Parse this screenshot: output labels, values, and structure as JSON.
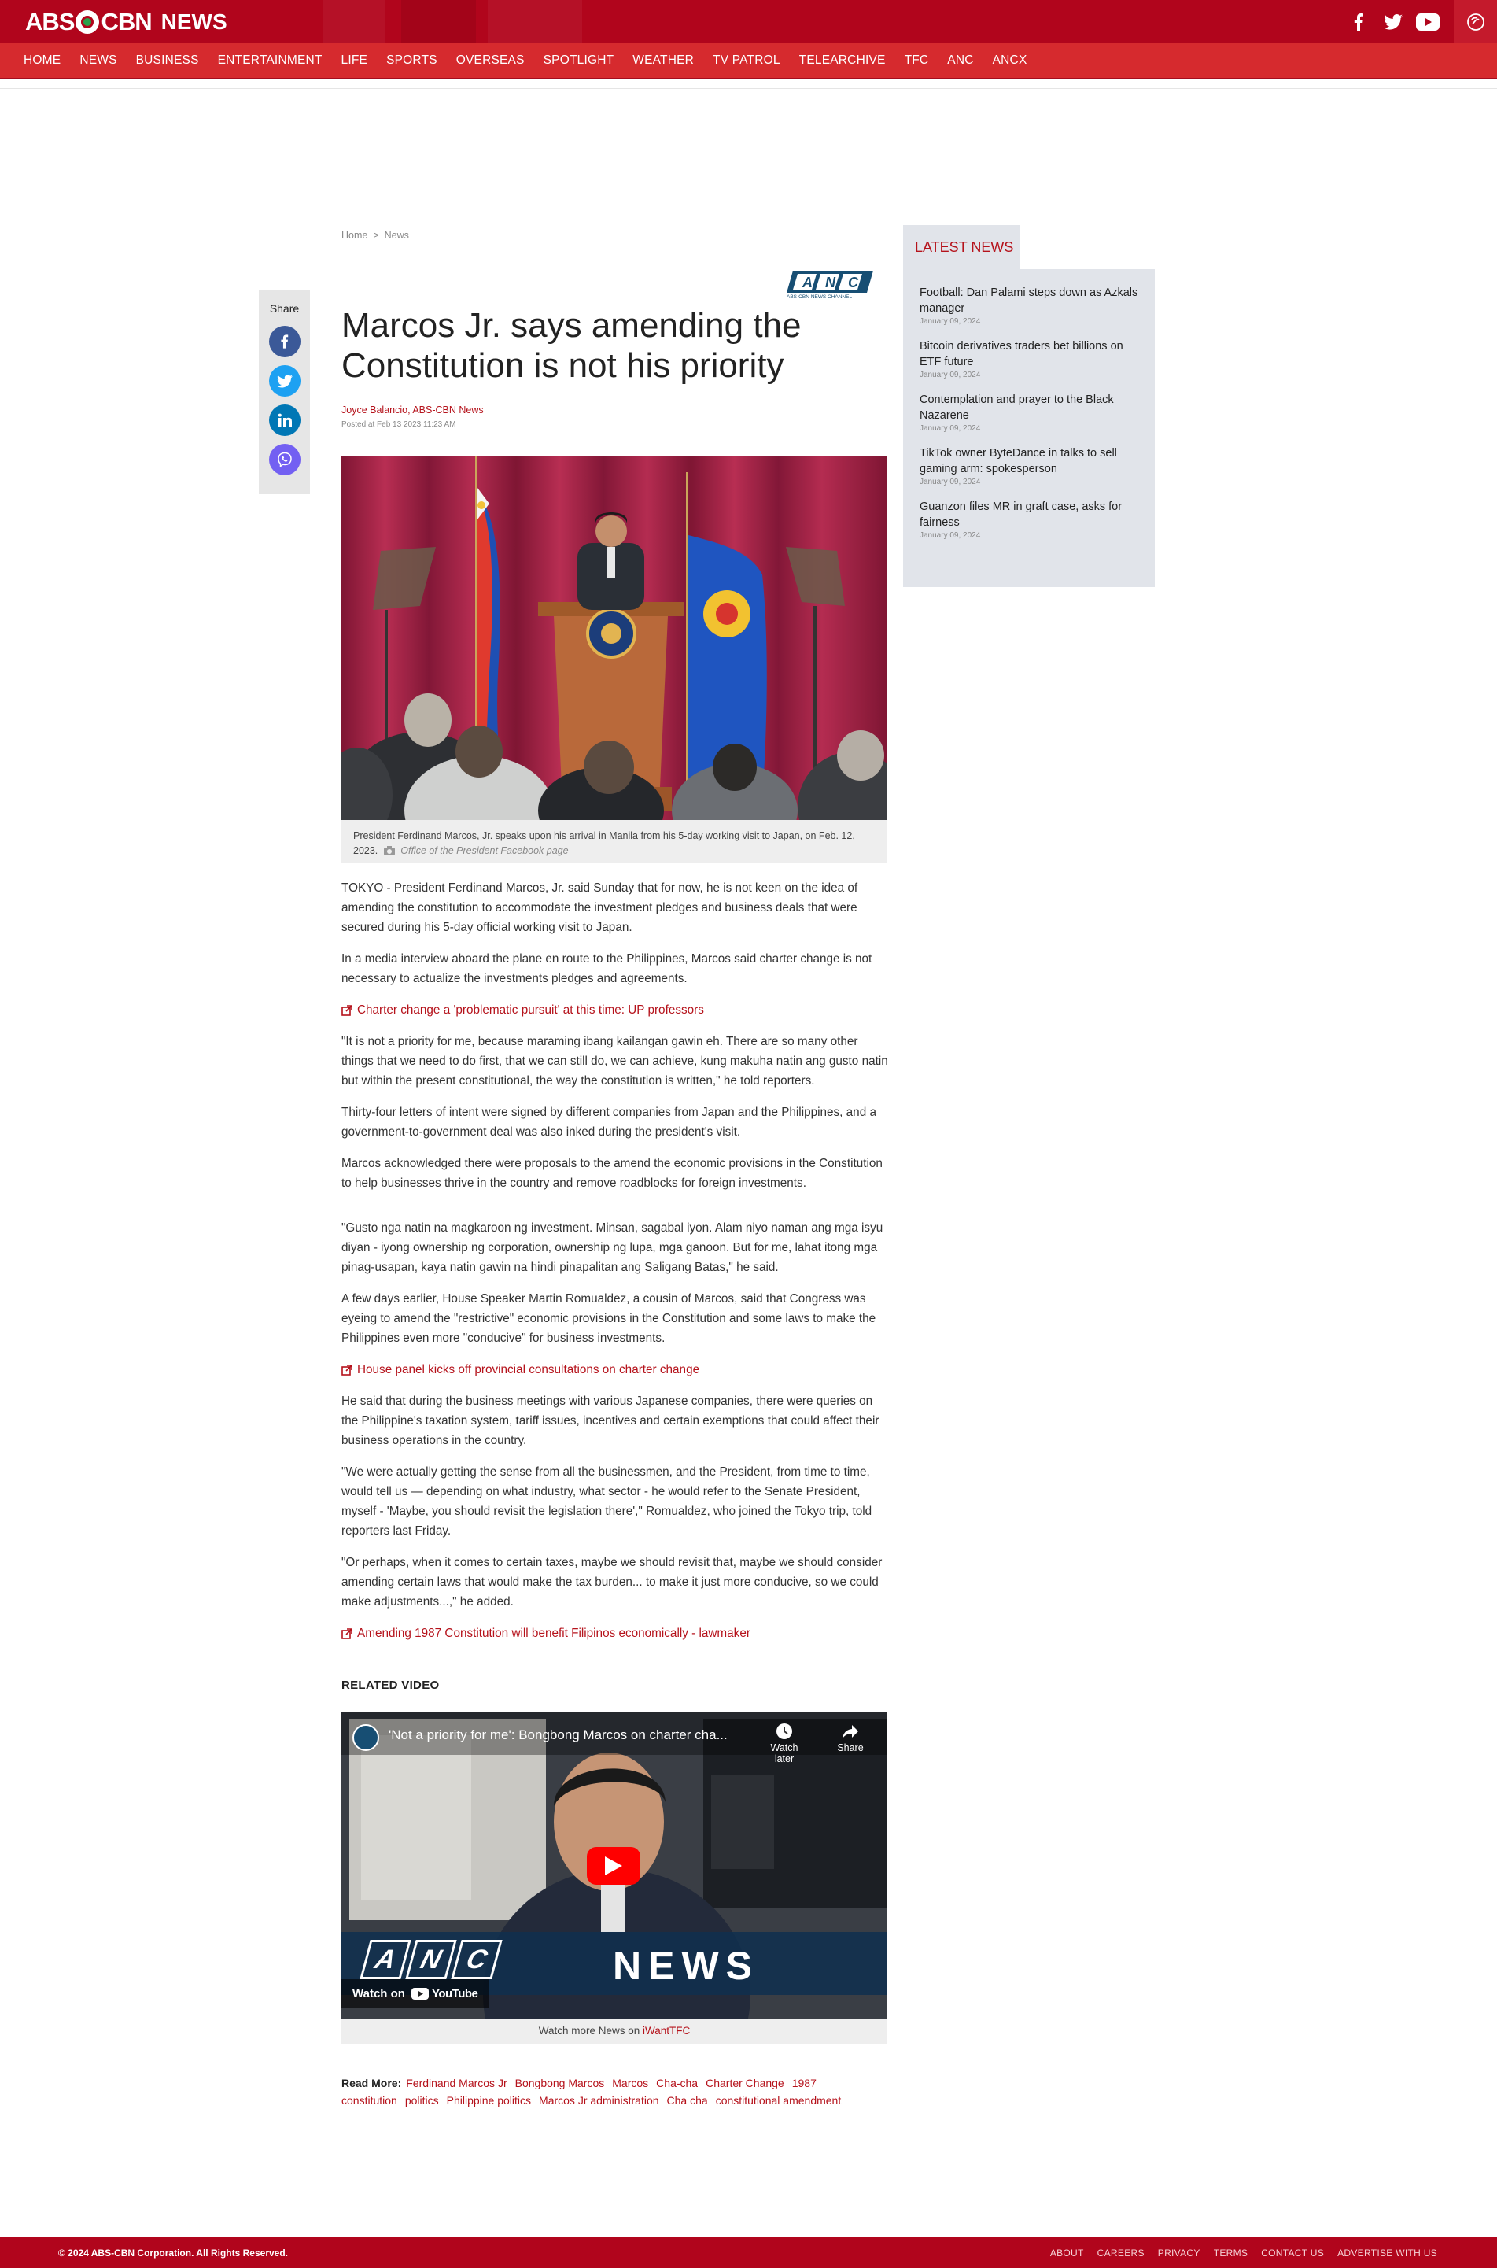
{
  "brand": {
    "logo_left": "ABS",
    "logo_right": "CBN",
    "logo_news": "NEWS"
  },
  "nav": [
    "HOME",
    "NEWS",
    "BUSINESS",
    "ENTERTAINMENT",
    "LIFE",
    "SPORTS",
    "OVERSEAS",
    "SPOTLIGHT",
    "WEATHER",
    "TV PATROL",
    "TELEARCHIVE",
    "TFC",
    "ANC",
    "ANCX"
  ],
  "social_top": [
    "facebook-icon",
    "twitter-icon",
    "youtube-icon",
    "sso-icon"
  ],
  "breadcrumb": {
    "home": "Home",
    "sep": ">",
    "section": "News"
  },
  "share": {
    "label": "Share",
    "buttons": [
      {
        "name": "facebook",
        "color": "#3b5998"
      },
      {
        "name": "twitter",
        "color": "#1da1f2"
      },
      {
        "name": "linkedin",
        "color": "#0077b5"
      },
      {
        "name": "viber",
        "color": "#7360f2"
      }
    ]
  },
  "article": {
    "anc_logo_text": "ANC",
    "anc_logo_sub": "ABS-CBN NEWS CHANNEL",
    "title": "Marcos Jr. says amending the Constitution is not his priority",
    "author": "Joyce Balancio, ABS-CBN News",
    "posted": "Posted at Feb 13 2023 11:23 AM",
    "caption": "President Ferdinand Marcos, Jr. speaks upon his arrival in Manila from his 5-day working visit to Japan, on Feb. 12, 2023.",
    "credit": "Office of the President Facebook page",
    "p1": "TOKYO - President Ferdinand Marcos, Jr. said Sunday that for now, he is not keen on the idea of amending the constitution to accommodate the investment pledges and business deals that were secured during his 5-day official working visit to Japan.",
    "p2": "In a media interview aboard the plane en route to the Philippines, Marcos said charter change is not necessary to actualize the investments pledges and agreements.",
    "rel1": "Charter change a 'problematic pursuit' at this time: UP professors",
    "p3": "\"It is not a priority for me, because maraming ibang kailangan gawin eh. There are so many other things that we need to do first, that we can still do, we can achieve, kung makuha natin ang gusto natin but within the present constitutional, the way the constitution is written,\" he told reporters.",
    "p4": "Thirty-four letters of intent were signed by different companies from Japan and the Philippines, and a government-to-government deal was also inked during the president's visit.",
    "p5": "Marcos acknowledged there were proposals to the amend the economic provisions in the Constitution to help businesses thrive in the country and remove roadblocks for foreign investments.",
    "p6": "\"Gusto nga natin na magkaroon ng investment. Minsan, sagabal iyon. Alam niyo naman ang mga isyu diyan - iyong ownership ng corporation, ownership ng lupa, mga ganoon. But for me, lahat itong mga pinag-usapan, kaya natin gawin na hindi pinapalitan ang Saligang Batas,\" he said.",
    "p7": "A few days earlier, House Speaker Martin Romualdez, a cousin of Marcos, said that Congress was eyeing to amend the \"restrictive\" economic provisions in the Constitution and some laws to make the Philippines even more \"conducive\" for business investments.",
    "rel2": "House panel kicks off provincial consultations on charter change",
    "p8": "He said that during the business meetings with various Japanese companies, there were queries on the Philippine's taxation system, tariff issues, incentives and certain exemptions that could affect their business operations in the country.",
    "p9": "\"We were actually getting the sense from all the businessmen, and the President, from time to time, would tell us — depending on what industry, what sector - he would refer to the Senate President, myself - 'Maybe, you should revisit the legislation there',\" Romualdez, who joined the Tokyo trip, told reporters last Friday.",
    "p10": "\"Or perhaps, when it comes to certain taxes, maybe we should revisit that, maybe we should consider amending certain laws that would make the tax burden... to make it just more conducive, so we could make adjustments...,\" he added.",
    "rel3": "Amending 1987 Constitution will benefit Filipinos economically - lawmaker",
    "related_video_heading": "RELATED VIDEO"
  },
  "video": {
    "title": "'Not a priority for me': Bongbong Marcos on charter cha...",
    "watch_later": "Watch later",
    "share": "Share",
    "watch_on": "Watch on",
    "youtube": "YouTube",
    "banner_anc": "ANC",
    "banner_news": "NEWS",
    "watch_more_prefix": "Watch more News on ",
    "watch_more_link": "iWantTFC"
  },
  "read_more": {
    "label": "Read More:",
    "tags": [
      "Ferdinand Marcos Jr",
      "Bongbong Marcos",
      "Marcos",
      "Cha-cha",
      "Charter Change",
      "1987 constitution",
      "politics",
      "Philippine politics",
      "Marcos Jr administration",
      "Cha cha",
      "constitutional amendment"
    ]
  },
  "latest": {
    "heading": "LATEST NEWS",
    "items": [
      {
        "headline": "Football: Dan Palami steps down as Azkals manager",
        "date": "January 09, 2024"
      },
      {
        "headline": "Bitcoin derivatives traders bet billions on ETF future",
        "date": "January 09, 2024"
      },
      {
        "headline": "Contemplation and prayer to the Black Nazarene",
        "date": "January 09, 2024"
      },
      {
        "headline": "TikTok owner ByteDance in talks to sell gaming arm: spokesperson",
        "date": "January 09, 2024"
      },
      {
        "headline": "Guanzon files MR in graft case, asks for fairness",
        "date": "January 09, 2024"
      }
    ]
  },
  "footer": {
    "copyright": "© 2024 ABS-CBN Corporation. All Rights Reserved.",
    "links": [
      "ABOUT",
      "CAREERS",
      "PRIVACY",
      "TERMS",
      "CONTACT US",
      "ADVERTISE WITH US"
    ]
  },
  "colors": {
    "brand_red": "#b1051c",
    "nav_red": "#d62a2e",
    "link_red": "#b5121b"
  }
}
